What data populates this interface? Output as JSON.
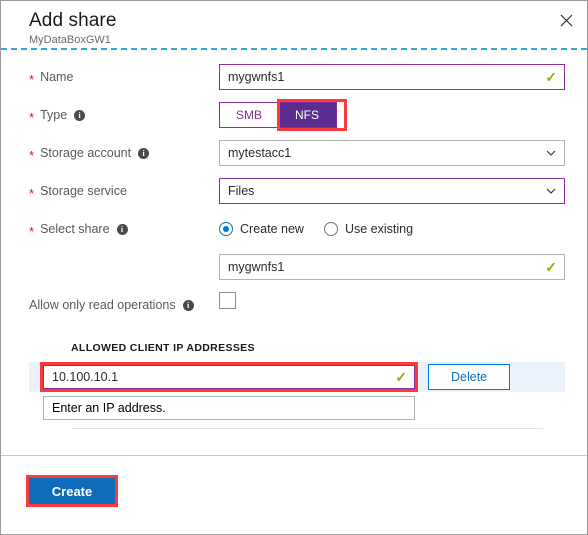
{
  "header": {
    "title": "Add share",
    "subtitle": "MyDataBoxGW1",
    "close_icon": "close-icon"
  },
  "form": {
    "name": {
      "label": "Name",
      "required_marker": "*",
      "value": "mygwnfs1",
      "valid_icon": "✓"
    },
    "type": {
      "label": "Type",
      "required_marker": "*",
      "info_icon": "i",
      "options": [
        "SMB",
        "NFS"
      ],
      "selected": "NFS"
    },
    "storage_account": {
      "label": "Storage account",
      "required_marker": "*",
      "info_icon": "i",
      "value": "mytestacc1"
    },
    "storage_service": {
      "label": "Storage service",
      "required_marker": "*",
      "value": "Files"
    },
    "select_share": {
      "label": "Select share",
      "required_marker": "*",
      "info_icon": "i",
      "options": [
        "Create new",
        "Use existing"
      ],
      "selected": "Create new",
      "share_name_value": "mygwnfs1",
      "valid_icon": "✓"
    },
    "read_only": {
      "label": "Allow only read operations",
      "info_icon": "i",
      "checked": false
    }
  },
  "allowed_ips": {
    "section_title": "ALLOWED CLIENT IP ADDRESSES",
    "rows": [
      {
        "value": "10.100.10.1",
        "valid_icon": "✓",
        "delete_label": "Delete"
      }
    ],
    "new_row_placeholder": "Enter an IP address."
  },
  "footer": {
    "create_label": "Create"
  },
  "colors": {
    "accent_purple": "#5c2d91",
    "border_purple": "#8a2f9e",
    "highlight_red": "#fb3b3b",
    "primary_blue": "#0f6cbd",
    "radio_blue": "#0078d4",
    "valid_green": "#7fba00",
    "required_red": "#e81123",
    "dashed_cyan": "#2ea9d8",
    "row_bg_blue": "#eaf3fb"
  }
}
